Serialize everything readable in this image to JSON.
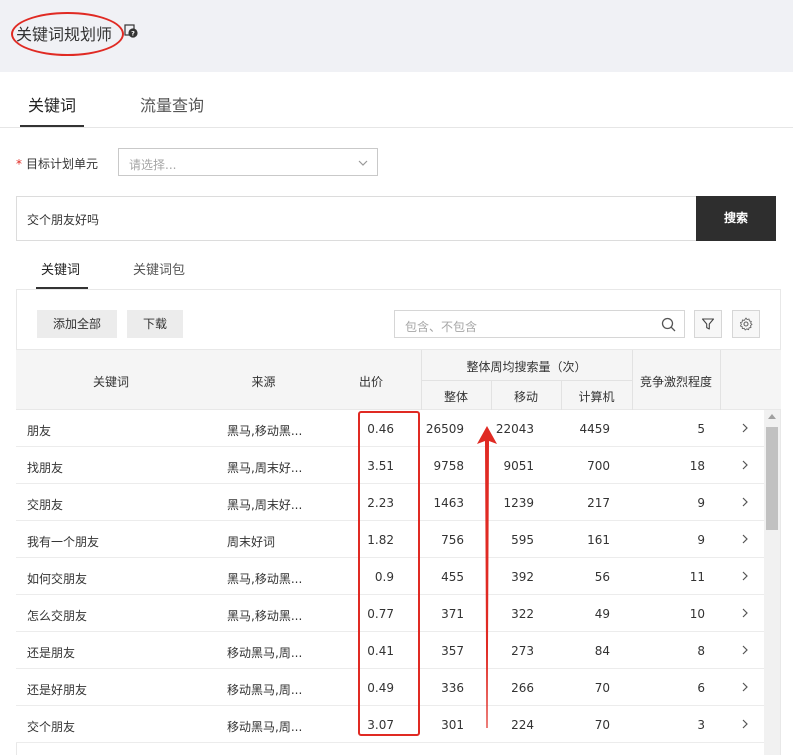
{
  "header": {
    "title": "关键词规划师"
  },
  "main_tabs": [
    {
      "label": "关键词"
    },
    {
      "label": "流量查询"
    }
  ],
  "target": {
    "label": "目标计划单元",
    "required_mark": "*",
    "placeholder": "请选择..."
  },
  "search": {
    "value": "交个朋友好吗",
    "button": "搜索"
  },
  "sub_tabs": [
    {
      "label": "关键词"
    },
    {
      "label": "关键词包"
    }
  ],
  "toolbar": {
    "add_all": "添加全部",
    "download": "下载",
    "filter_placeholder": "包含、不包含"
  },
  "table": {
    "headers": {
      "keyword": "关键词",
      "source": "来源",
      "bid": "出价",
      "weekly_search": "整体周均搜索量（次）",
      "overall": "整体",
      "mobile": "移动",
      "computer": "计算机",
      "competition": "竞争激烈程度"
    },
    "rows": [
      {
        "keyword": "朋友",
        "source": "黑马,移动黑...",
        "bid": "0.46",
        "overall": "26509",
        "mobile": "22043",
        "computer": "4459",
        "competition": "5"
      },
      {
        "keyword": "找朋友",
        "source": "黑马,周末好...",
        "bid": "3.51",
        "overall": "9758",
        "mobile": "9051",
        "computer": "700",
        "competition": "18"
      },
      {
        "keyword": "交朋友",
        "source": "黑马,周末好...",
        "bid": "2.23",
        "overall": "1463",
        "mobile": "1239",
        "computer": "217",
        "competition": "9"
      },
      {
        "keyword": "我有一个朋友",
        "source": "周末好词",
        "bid": "1.82",
        "overall": "756",
        "mobile": "595",
        "computer": "161",
        "competition": "9"
      },
      {
        "keyword": "如何交朋友",
        "source": "黑马,移动黑...",
        "bid": "0.9",
        "overall": "455",
        "mobile": "392",
        "computer": "56",
        "competition": "11"
      },
      {
        "keyword": "怎么交朋友",
        "source": "黑马,移动黑...",
        "bid": "0.77",
        "overall": "371",
        "mobile": "322",
        "computer": "49",
        "competition": "10"
      },
      {
        "keyword": "还是朋友",
        "source": "移动黑马,周...",
        "bid": "0.41",
        "overall": "357",
        "mobile": "273",
        "computer": "84",
        "competition": "8"
      },
      {
        "keyword": "还是好朋友",
        "source": "移动黑马,周...",
        "bid": "0.49",
        "overall": "336",
        "mobile": "266",
        "computer": "70",
        "competition": "6"
      },
      {
        "keyword": "交个朋友",
        "source": "移动黑马,周...",
        "bid": "3.07",
        "overall": "301",
        "mobile": "224",
        "computer": "70",
        "competition": "3"
      }
    ]
  },
  "colors": {
    "annotation_red": "#e02a23",
    "search_button_bg": "#2e2e2e",
    "header_bg": "#f0f1f5"
  }
}
